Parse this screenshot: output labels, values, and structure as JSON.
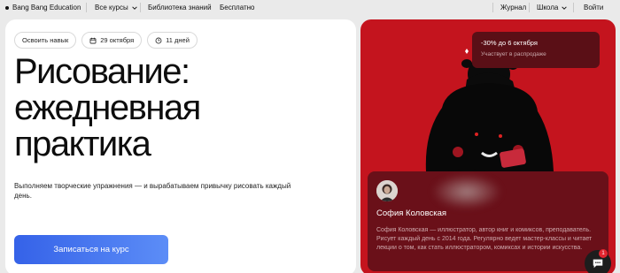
{
  "nav": {
    "brand": "Bang Bang Education",
    "courses": "Все курсы",
    "library": "Библиотека знаний",
    "free": "Бесплатно",
    "journal": "Журнал",
    "school": "Школа",
    "login": "Войти"
  },
  "hero": {
    "chips": {
      "skill": "Освоить навык",
      "date": "29 октября",
      "duration": "11 дней"
    },
    "title_lines": [
      "Рисование:",
      "ежедневная",
      "практика"
    ],
    "description": "Выполняем творческие упражнения — и вырабатываем привычку рисовать каждый день.",
    "cta_label": "Записаться на курс"
  },
  "sale": {
    "title": "-30% до 6 октября",
    "subtitle": "Участвует в распродаже"
  },
  "author": {
    "name": "София Коловская",
    "bio": "София Коловская — иллюстратор, автор книг и комиксов, преподаватель. Рисует каждый день с 2014 года. Регулярно ведет мастер-классы и читает лекции о том, как стать иллюстратором, комиксах и истории искусства."
  },
  "chat": {
    "badge": "1"
  },
  "colors": {
    "accent_blue": "#3562e8",
    "hero_red": "#c4141e",
    "sale_bg": "#5a0f16",
    "author_bg": "#6a1019"
  }
}
